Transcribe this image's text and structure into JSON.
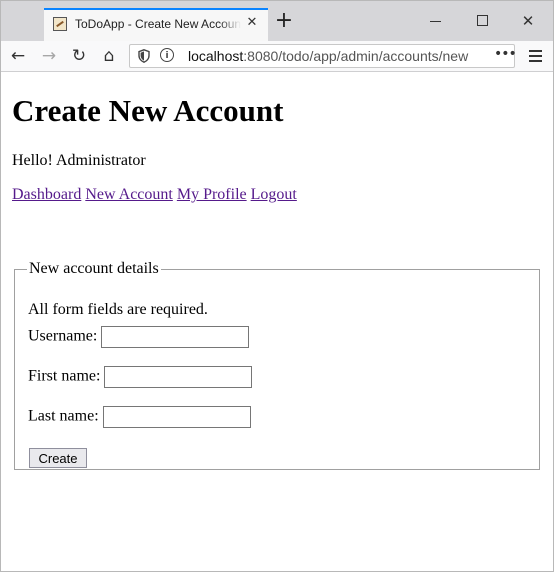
{
  "browser": {
    "tab_title": "ToDoApp - Create New Account",
    "close_glyph": "✕",
    "new_tab_glyph": "+",
    "url_host": "localhost",
    "url_rest": ":8080/todo/app/admin/accounts/new",
    "info_glyph": "i",
    "overflow_glyph": "•••",
    "icons": {
      "back": "←",
      "forward": "→",
      "reload": "↻",
      "home": "⌂",
      "window_close": "✕"
    }
  },
  "page": {
    "title": "Create New Account",
    "greeting": "Hello! Administrator",
    "nav_links": [
      "Dashboard",
      "New Account",
      "My Profile",
      "Logout"
    ],
    "form": {
      "legend": "New account details",
      "note": "All form fields are required.",
      "fields": [
        {
          "label": "Username:",
          "value": ""
        },
        {
          "label": "First name:",
          "value": ""
        },
        {
          "label": "Last name:",
          "value": ""
        }
      ],
      "submit_label": "Create"
    }
  },
  "colors": {
    "link_visited": "#551a8b",
    "tab_accent": "#0a84ff",
    "tab_strip": "#d6d6d9"
  }
}
